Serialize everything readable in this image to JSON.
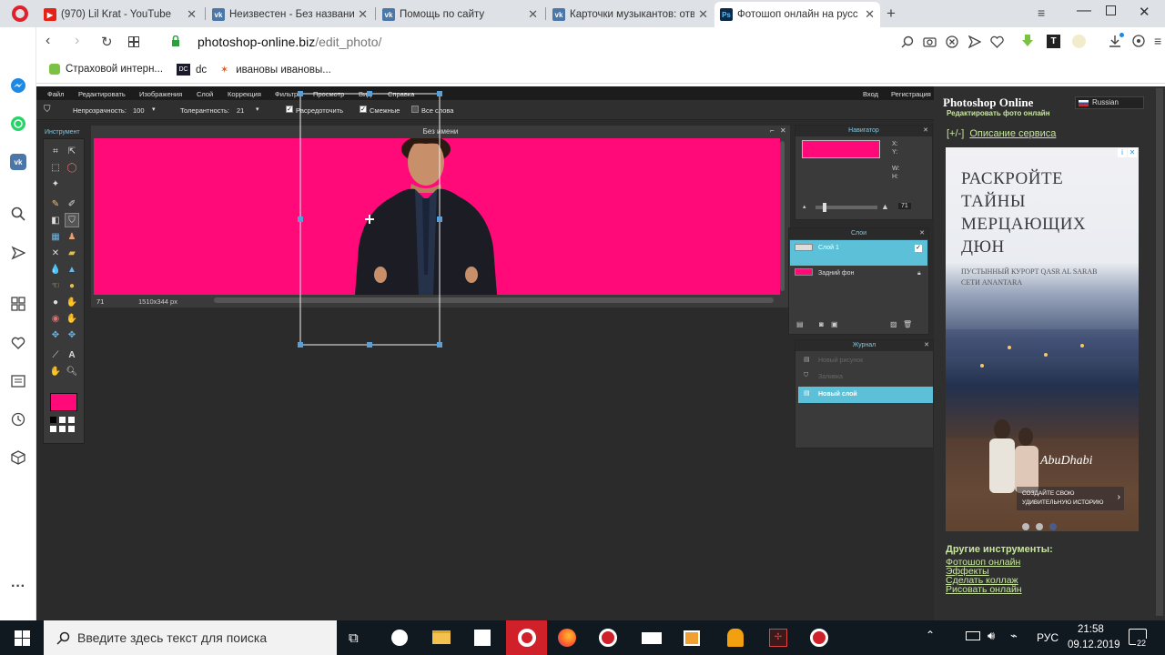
{
  "browser": {
    "tabs": [
      {
        "label": "(970) Lil Krat - YouTube",
        "icon": "youtube-icon"
      },
      {
        "label": "Неизвестен - Без названи",
        "icon": "vk-icon"
      },
      {
        "label": "Помощь по сайту",
        "icon": "vk-icon"
      },
      {
        "label": "Карточки музыкантов: отв",
        "icon": "vk-icon"
      },
      {
        "label": "Фотошоп онлайн на русс",
        "icon": "photoshop-icon"
      }
    ],
    "url_domain": "photoshop-online.biz",
    "url_path": "/edit_photo/",
    "bookmarks": [
      "Страховой интерн...",
      "dc",
      "ивановы ивановы..."
    ]
  },
  "app": {
    "menu": [
      "Файл",
      "Редактировать",
      "Изображения",
      "Слой",
      "Коррекция",
      "Фильтр",
      "Просмотр",
      "Вид",
      "Справка"
    ],
    "login": "Вход",
    "register": "Регистрация",
    "options": {
      "opacity_label": "Непрозрачность:",
      "opacity_value": "100",
      "tolerance_label": "Толерантность:",
      "tolerance_value": "21",
      "antialias": "Расредоточить",
      "contiguous": "Смежные",
      "all_layers": "Все слова"
    },
    "toolbox_title": "Инструмент",
    "document_title": "Без имени",
    "zoom": "71",
    "doc_size": "1510x344 px",
    "navigator": {
      "title": "Навигатор",
      "x_label": "X:",
      "y_label": "Y:",
      "w_label": "W:",
      "h_label": "H:",
      "zoom": "71"
    },
    "layers": {
      "title": "Слои",
      "items": [
        "Слой 1",
        "Задний фон"
      ]
    },
    "history": {
      "title": "Журнал",
      "items": [
        "Новый рисунок",
        "Заливка",
        "Новый слой"
      ]
    }
  },
  "site": {
    "title": "Photoshop Online",
    "subtitle": "Редактировать фото онлайн",
    "lang": "Russian",
    "toggle": "[+/-]",
    "desc_link": "Описание сервиса",
    "ad": {
      "headline": "РАСКРОЙТЕ ТАЙНЫ МЕРЦАЮЩИХ ДЮН",
      "sub": "ПУСТЫННЫЙ КУРОРТ QASR AL SARAB СЕТИ ANANTARA",
      "brand": "AbuDhabi",
      "cta": "СОЗДАЙТЕ СВОЮ УДИВИТЕЛЬНУЮ ИСТОРИЮ"
    },
    "other_tools_title": "Другие инструменты:",
    "other_tools": [
      "Фотошоп онлайн",
      "Эффекты",
      "Сделать коллаж",
      "Рисовать онлайн"
    ]
  },
  "taskbar": {
    "search_placeholder": "Введите здесь текст для поиска",
    "lang": "РУС",
    "time": "21:58",
    "date": "09.12.2019",
    "notifications": "22"
  },
  "colors": {
    "canvas": "#ff0a78",
    "accent": "#5bc0d8",
    "link": "#c8e6a0"
  }
}
